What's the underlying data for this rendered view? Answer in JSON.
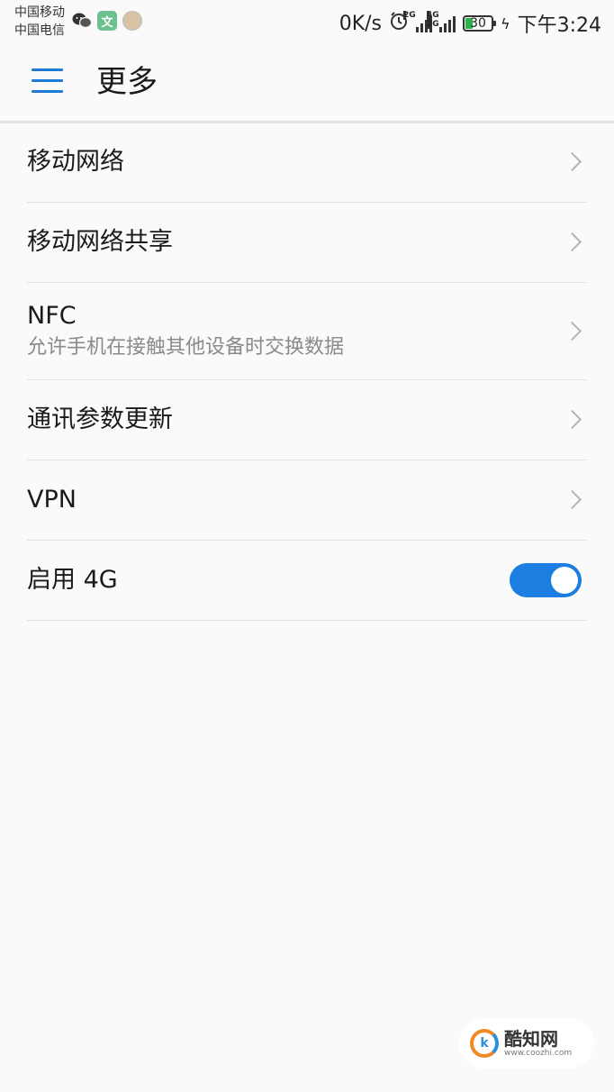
{
  "status_bar": {
    "carrier_1": "中国移动",
    "carrier_2": "中国电信",
    "left_icons": [
      "wechat-icon",
      "wenku-icon",
      "avatar-icon"
    ],
    "wenku_glyph": "文",
    "net_speed": "0K/s",
    "signal_1_tag": "2G",
    "signal_2_tag": "4G\n2G",
    "battery_level": "30",
    "time": "下午3:24"
  },
  "header": {
    "title": "更多",
    "menu_icon": "hamburger-menu-icon"
  },
  "items": [
    {
      "label": "移动网络",
      "control": "chevron"
    },
    {
      "label": "移动网络共享",
      "control": "chevron"
    },
    {
      "label": "NFC",
      "subtitle": "允许手机在接触其他设备时交换数据",
      "control": "chevron"
    },
    {
      "label": "通讯参数更新",
      "control": "chevron"
    },
    {
      "label": "VPN",
      "control": "chevron"
    },
    {
      "label": "启用 4G",
      "control": "toggle",
      "toggle_on": true
    }
  ],
  "watermark": {
    "name": "酷知网",
    "url": "www.coozhi.com"
  },
  "colors": {
    "accent": "#1b7ee0",
    "background": "#fafafa",
    "divider": "#e2e2e2",
    "subtitle": "#8a8a8a"
  }
}
